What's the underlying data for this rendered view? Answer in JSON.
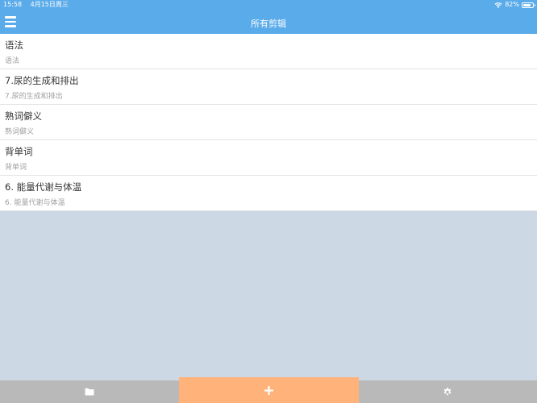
{
  "status_bar": {
    "time": "15:58",
    "date": "4月15日周三",
    "battery": "82%",
    "battery_level": 0.82
  },
  "nav": {
    "title": "所有剪辑",
    "menu_icon": "hamburger-menu-icon"
  },
  "clips": [
    {
      "title": "语法",
      "subtitle": "语法"
    },
    {
      "title": "7.尿的生成和排出",
      "subtitle": "7.尿的生成和排出"
    },
    {
      "title": "熟词僻义",
      "subtitle": "熟词僻义"
    },
    {
      "title": "背单词",
      "subtitle": "背单词"
    },
    {
      "title": "6. 能量代谢与体温",
      "subtitle": "6. 能量代谢与体温"
    }
  ],
  "toolbar": {
    "folder_icon": "folder-icon",
    "add_icon": "plus-icon",
    "settings_icon": "gear-icon"
  },
  "colors": {
    "header": "#5aabea",
    "background": "#ccd8e4",
    "toolbar": "#b9b9b9",
    "add_button": "#ffb27a"
  }
}
